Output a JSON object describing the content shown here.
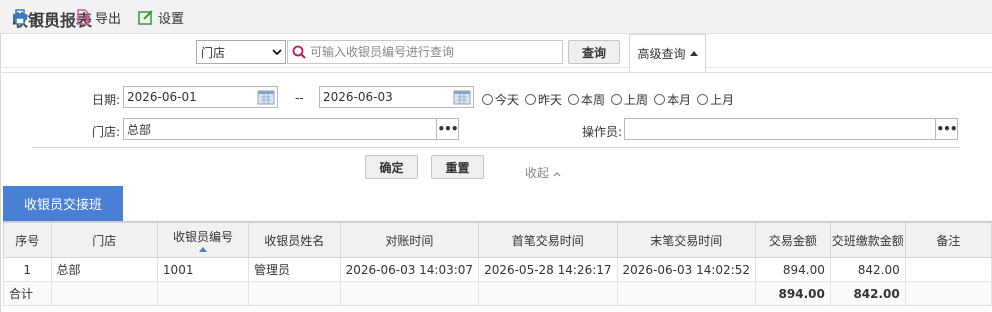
{
  "header": {
    "title": "收银员报表"
  },
  "toolbar": {
    "print_label": "打印",
    "export_label": "导出",
    "settings_label": "设置",
    "store_select_value": "门店",
    "search_placeholder": "可输入收银员编号进行查询",
    "query_label": "查询",
    "advanced_label": "高级查询"
  },
  "filters": {
    "date_label": "日期:",
    "date_from": "2026-06-01",
    "date_sep": "--",
    "date_to": "2026-06-03",
    "quick": [
      "今天",
      "昨天",
      "本周",
      "上周",
      "本月",
      "上月"
    ],
    "store_label": "门店:",
    "store_value": "总部",
    "operator_label": "操作员:",
    "operator_value": "",
    "confirm_label": "确定",
    "reset_label": "重置",
    "collapse_label": "收起"
  },
  "tabs": {
    "main": "收银员交接班"
  },
  "table": {
    "columns": [
      "序号",
      "门店",
      "收银员编号",
      "收银员姓名",
      "对账时间",
      "首笔交易时间",
      "末笔交易时间",
      "交易金额",
      "交班缴款金额",
      "备注"
    ],
    "rows": [
      [
        "1",
        "总部",
        "1001",
        "管理员",
        "2026-06-03 14:03:07",
        "2026-05-28 14:26:17",
        "2026-06-03 14:02:52",
        "894.00",
        "842.00",
        ""
      ]
    ],
    "total": {
      "label": "合计",
      "amount": "894.00",
      "payment": "842.00"
    }
  },
  "colors": {
    "accent": "#4a7fd6",
    "search_icon": "#c2185b",
    "icon_blue": "#3a78c2",
    "icon_green": "#3a9a3a",
    "icon_pink": "#d05aa0"
  }
}
